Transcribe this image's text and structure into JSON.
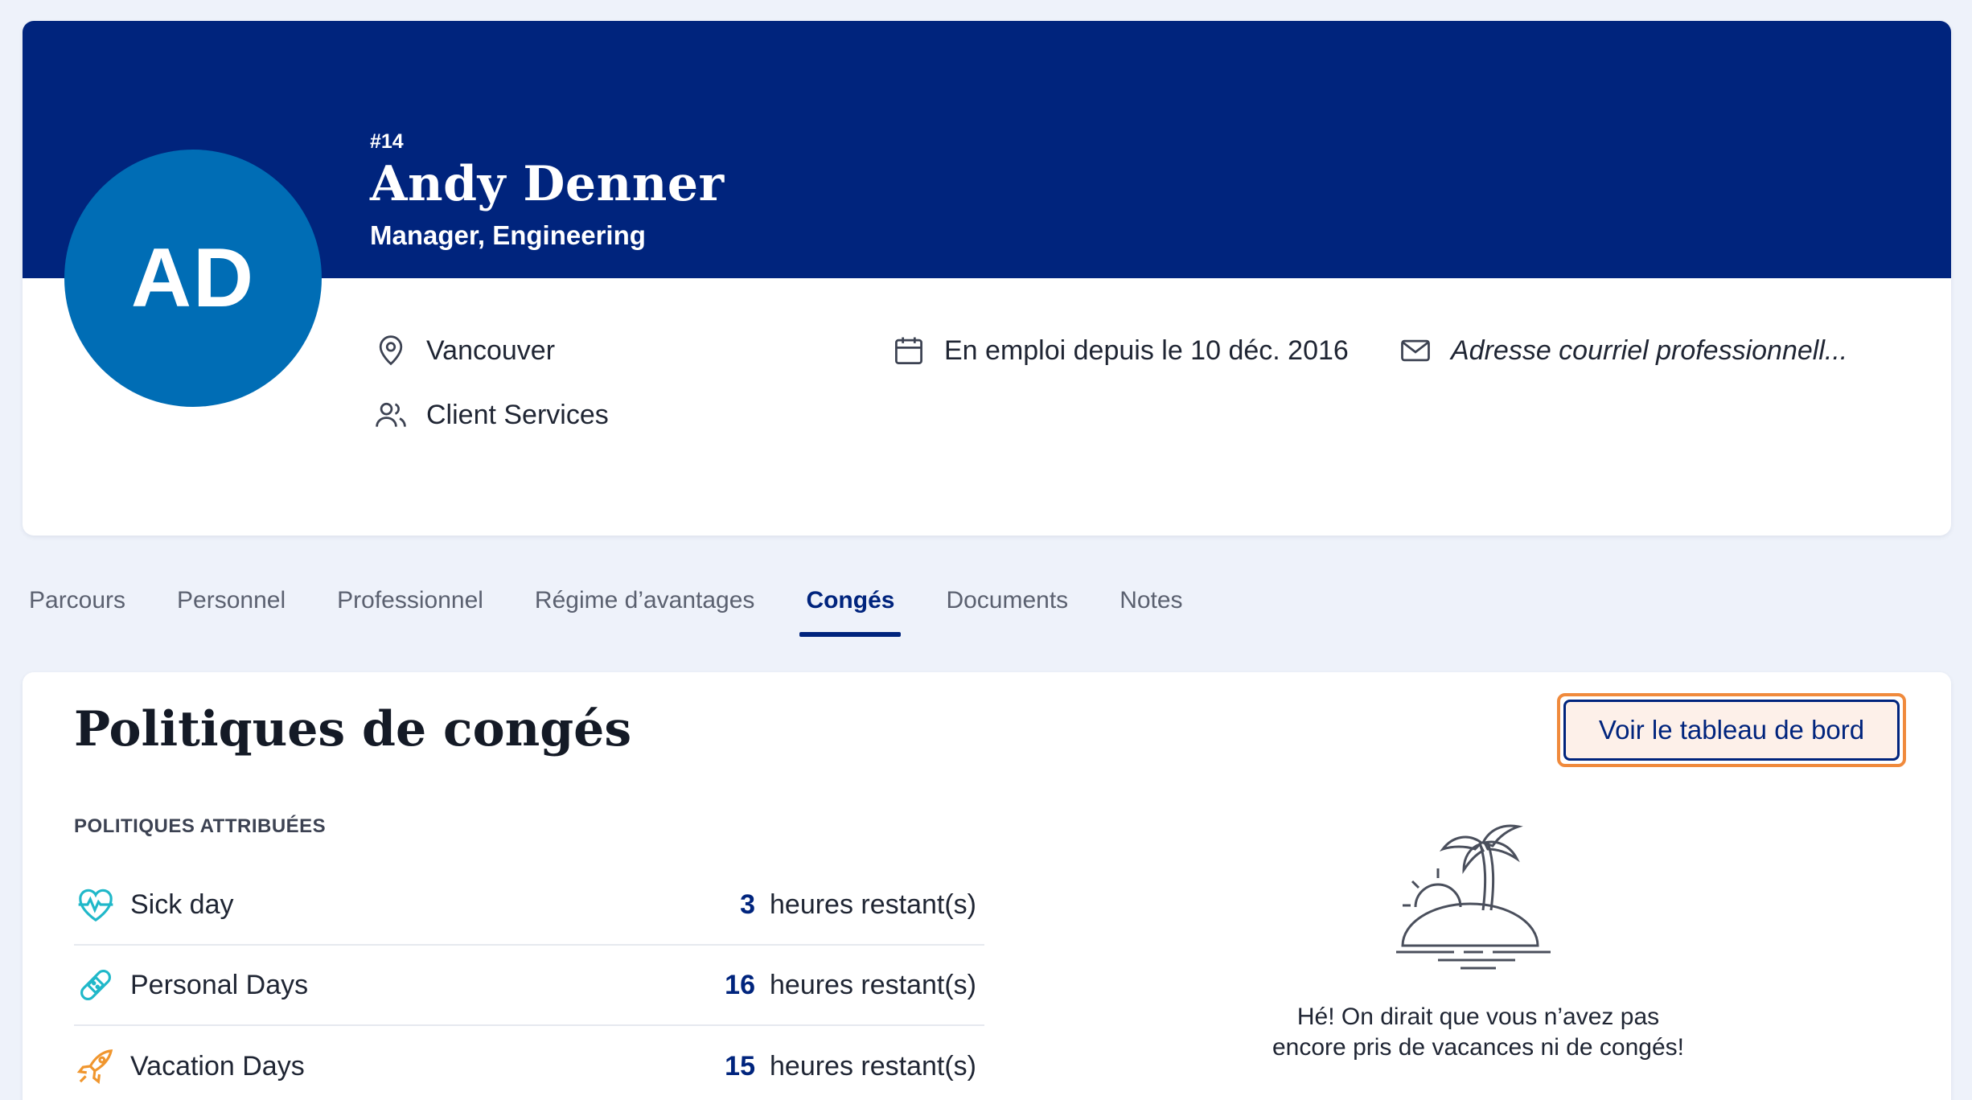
{
  "profile": {
    "initials": "AD",
    "employee_id": "#14",
    "name": "Andy Denner",
    "job_title": "Manager, Engineering",
    "location": "Vancouver",
    "department": "Client Services",
    "employment_start": "En emploi depuis le 10 déc. 2016",
    "work_email": "Adresse courriel professionnell...",
    "colors": {
      "banner": "#00247d",
      "avatar": "#006db5"
    }
  },
  "tabs": [
    {
      "label": "Parcours",
      "active": false
    },
    {
      "label": "Personnel",
      "active": false
    },
    {
      "label": "Professionnel",
      "active": false
    },
    {
      "label": "Régime d’avantages",
      "active": false
    },
    {
      "label": "Congés",
      "active": true
    },
    {
      "label": "Documents",
      "active": false
    },
    {
      "label": "Notes",
      "active": false
    }
  ],
  "policies": {
    "title": "Politiques de congés",
    "dashboard_button": "Voir le tableau de bord",
    "section_label": "POLITIQUES ATTRIBUÉES",
    "items": [
      {
        "icon": "heart-pulse-icon",
        "name": "Sick day",
        "value": "3",
        "unit": "heures restant(s)"
      },
      {
        "icon": "bandage-icon",
        "name": "Personal Days",
        "value": "16",
        "unit": "heures restant(s)"
      },
      {
        "icon": "rocket-icon",
        "name": "Vacation Days",
        "value": "15",
        "unit": "heures restant(s)"
      }
    ],
    "empty_state": {
      "icon": "island-icon",
      "line1": "Hé! On dirait que vous n’avez pas",
      "line2": "encore pris de vacances ni de congés!"
    }
  }
}
